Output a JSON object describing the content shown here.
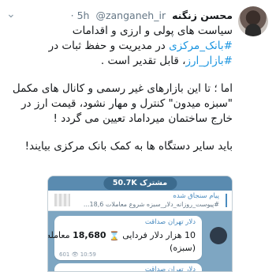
{
  "tweet": {
    "author_name": "محسن زنگنه",
    "handle": "@zanganeh_ir",
    "time": "· 5h",
    "menu_icon": "chevron-down-icon",
    "para1": {
      "t1": "سیاست های پولی و ارزی و اقدامات ",
      "h1": "#بانک_مرکزی",
      "t2": " در مدیریت و حفظ ثبات در ",
      "h2": "#بازار_ارز",
      "t3": "، قابل تقدیر است ."
    },
    "para2": "اما ؛ تا این بازارهای غیر رسمی و کانال های مکمل \"سبزه میدون\" کنترل و مهار نشود، قیمت ارز در خارج ساختمان میرداماد تعیین می گردد !",
    "para3": "باید سایر دستگاه ها به کمک بانک مرکزی بیایند!"
  },
  "embed": {
    "subscribers": "50.7K مشترک",
    "pinned_title": "پیام سنجاق شده",
    "pinned_text": "#پیوست_روزانه_دلار_سبزه  شروع معاملات 18,6...",
    "message_channel": "دلار تهران صداقت",
    "message_prefix": "10 هزار دلار فردایی",
    "message_price": "18,680",
    "message_suffix": "معامله",
    "message_line2": "(سبزه)",
    "message_meta": "601 👁 10:59",
    "second_channel": "دلار تهران صداقت",
    "colors": {
      "bar": "#5a8bb0",
      "link": "#4a8bbf",
      "check": "#3ca03c"
    }
  }
}
